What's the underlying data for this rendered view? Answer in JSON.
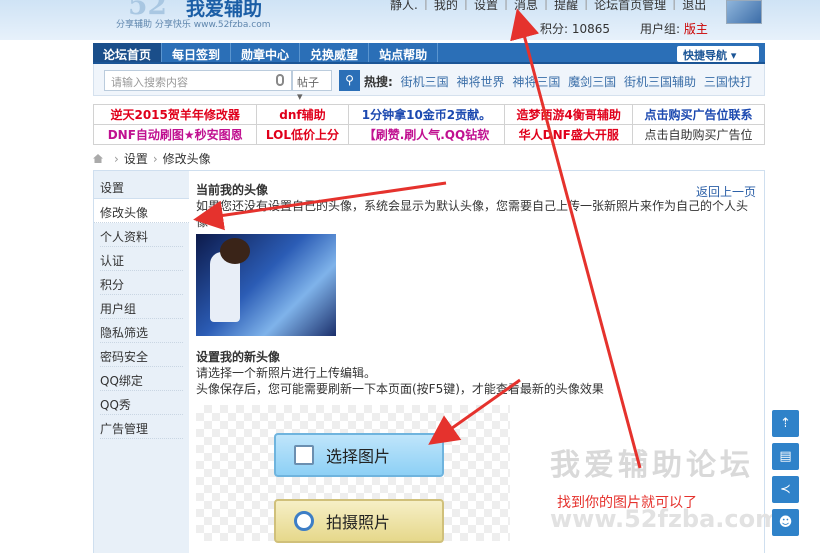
{
  "header": {
    "logo_number": "52",
    "logo_text": "我爱辅助",
    "logo_subtext": "分享辅助 分享快乐 www.52fzba.com",
    "top_links": [
      "静人.",
      "我的",
      "设置",
      "消息",
      "提醒",
      "论坛首页管理",
      "退出"
    ],
    "points_label": "积分: 10865",
    "group_label": "用户组:",
    "group_value": "版主"
  },
  "nav": {
    "items": [
      "论坛首页",
      "每日签到",
      "勋章中心",
      "兑换威望",
      "站点帮助"
    ],
    "quick_nav": "快捷导航"
  },
  "search": {
    "placeholder": "请输入搜索内容",
    "category": "帖子",
    "hot_label": "热搜:",
    "hot_items": [
      "街机三国",
      "神将世界",
      "神将三国",
      "魔剑三国",
      "街机三国辅助",
      "三国快打"
    ]
  },
  "ads": {
    "row1": [
      "逆天2015贺羊年修改器",
      "dnf辅助",
      "1分钟拿10金币2贡献。",
      "造梦西游4衡哥辅助",
      "点击购买广告位联系"
    ],
    "row2": [
      "DNF自动刷图★秒安图恩",
      "LOL低价上分",
      "【刷赞.刷人气.QQ钻软",
      "华人DNF盛大开服",
      "点击自助购买广告位"
    ],
    "colors_row1": [
      "#e0001b",
      "#e0001b",
      "#1c49b0",
      "#e0001b",
      "#1c49b0"
    ],
    "colors_row2": [
      "#c01090",
      "#e0001b",
      "#c01090",
      "#e0001b",
      "#333333"
    ]
  },
  "breadcrumb": {
    "items": [
      "设置",
      "修改头像"
    ]
  },
  "sidebar": {
    "title": "设置",
    "items": [
      "修改头像",
      "个人资料",
      "认证",
      "积分",
      "用户组",
      "隐私筛选",
      "密码安全",
      "QQ绑定",
      "QQ秀",
      "广告管理"
    ]
  },
  "main": {
    "current_title": "当前我的头像",
    "back_link": "返回上一页",
    "current_desc": "如果您还没有设置自己的头像，系统会显示为默认头像，您需要自己上传一张新照片来作为自己的个人头像",
    "new_title": "设置我的新头像",
    "new_desc1": "请选择一个新照片进行上传编辑。",
    "new_desc2": "头像保存后，您可能需要刷新一下本页面(按F5键)，才能查看最新的头像效果",
    "select_button": "选择图片",
    "camera_button": "拍摄照片"
  },
  "watermark": {
    "title": "我爱辅助论坛",
    "url": "www.52fzba.com"
  },
  "annotation": {
    "note": "找到你的图片就可以了"
  },
  "right_tools": [
    "top-icon",
    "doc-icon",
    "share-icon",
    "user-icon"
  ],
  "colors": {
    "nav_blue": "#2b6fb7",
    "accent_red": "#e5322d",
    "sidebar_bg": "#e8f0f8"
  }
}
